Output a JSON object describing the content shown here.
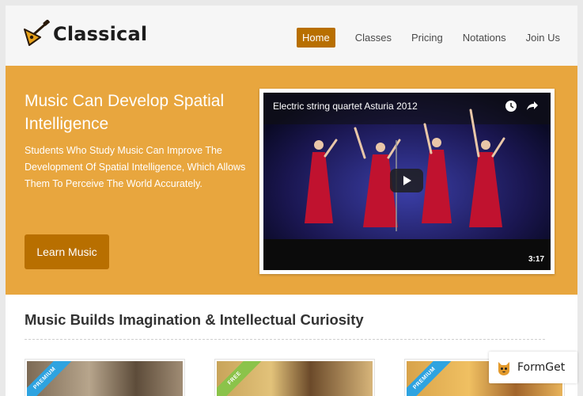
{
  "brand": {
    "name": "Classical",
    "logo_icon": "balalaika-icon"
  },
  "nav": [
    {
      "label": "Home",
      "active": true
    },
    {
      "label": "Classes",
      "active": false
    },
    {
      "label": "Pricing",
      "active": false
    },
    {
      "label": "Notations",
      "active": false
    },
    {
      "label": "Join Us",
      "active": false
    }
  ],
  "hero": {
    "title": "Music Can Develop Spatial Intelligence",
    "text": "Students Who Study Music Can Improve The Development Of Spatial Intelligence, Which Allows Them To Perceive The World Accurately.",
    "button": "Learn Music"
  },
  "video": {
    "title": "Electric string quartet Asturia 2012",
    "duration": "3:17",
    "icons": [
      "clock-icon",
      "share-icon",
      "play-icon"
    ]
  },
  "section": {
    "title": "Music Builds Imagination & Intellectual Curiosity"
  },
  "cards": [
    {
      "ribbon": "PREMIUM",
      "ribbon_color": "#2ea3e0"
    },
    {
      "ribbon": "FREE",
      "ribbon_color": "#8bc34a"
    },
    {
      "ribbon": "PREMIUM",
      "ribbon_color": "#2ea3e0"
    }
  ],
  "watermark": {
    "label": "FormGet"
  },
  "colors": {
    "accent": "#b86f00",
    "hero_bg": "#e8a63e",
    "header_bg": "#f6f6f6"
  }
}
